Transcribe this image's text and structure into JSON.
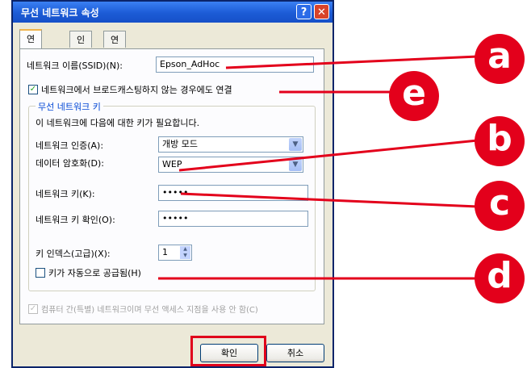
{
  "dialog": {
    "title": "무선 네트워크 속성",
    "help_glyph": "?",
    "close_glyph": "✕"
  },
  "tabs": [
    {
      "label": "연결 정보",
      "active": true
    },
    {
      "label": "인증",
      "active": false
    },
    {
      "label": "연결",
      "active": false
    }
  ],
  "form": {
    "ssid_label": "네트워크 이름(SSID)(N):",
    "ssid_value": "Epson_AdHoc",
    "broadcast_checkbox_label": "네트워크에서 브로드캐스팅하지 않는 경우에도 연결",
    "broadcast_checked": "✓",
    "group_title": "무선 네트워크 키",
    "group_desc": "이 네트워크에 다음에 대한 키가 필요합니다.",
    "auth_label": "네트워크 인증(A):",
    "auth_value": "개방 모드",
    "encryption_label": "데이터 암호화(D):",
    "encryption_value": "WEP",
    "key_label": "네트워크 키(K):",
    "key_value": "•••••",
    "key_confirm_label": "네트워크 키 확인(O):",
    "key_confirm_value": "•••••",
    "key_index_label": "키 인덱스(고급)(X):",
    "key_index_value": "1",
    "auto_key_label": "키가 자동으로 공급됨(H)",
    "adhoc_label": "컴퓨터 간(특별) 네트워크이며 무선 액세스 지점을 사용 안 함(C)",
    "adhoc_checked": "✓",
    "select_arrow": "▼",
    "spin_up": "▲",
    "spin_down": "▼"
  },
  "buttons": {
    "ok_label": "확인",
    "cancel_label": "취소"
  },
  "callouts": [
    "a",
    "e",
    "b",
    "c",
    "d"
  ],
  "colors": {
    "accent_red": "#E3001B",
    "xp_blue": "#1C5BD6"
  }
}
